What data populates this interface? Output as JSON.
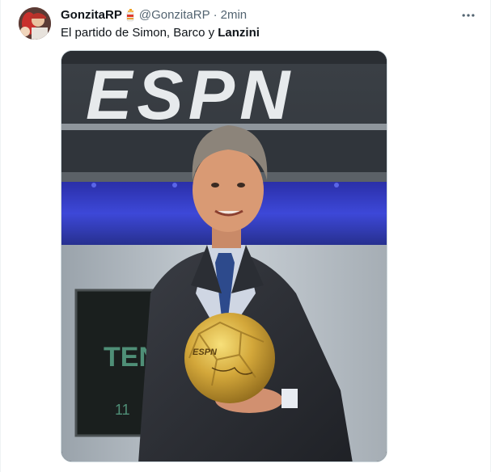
{
  "tweet": {
    "author": {
      "display_name": "GonzitaRP",
      "badge_icon": "fire-extinguisher-icon",
      "handle": "@GonzitaRP",
      "separator": "·",
      "time": "2min"
    },
    "text_before": "El partido de Simon, Barco y ",
    "text_bold": "Lanzini",
    "more_icon": "more-horizontal-icon"
  },
  "media": {
    "studio_logo": "ESPN",
    "screen_text": "TEN",
    "screen_small": "11",
    "ball_mark": "ESPN"
  }
}
